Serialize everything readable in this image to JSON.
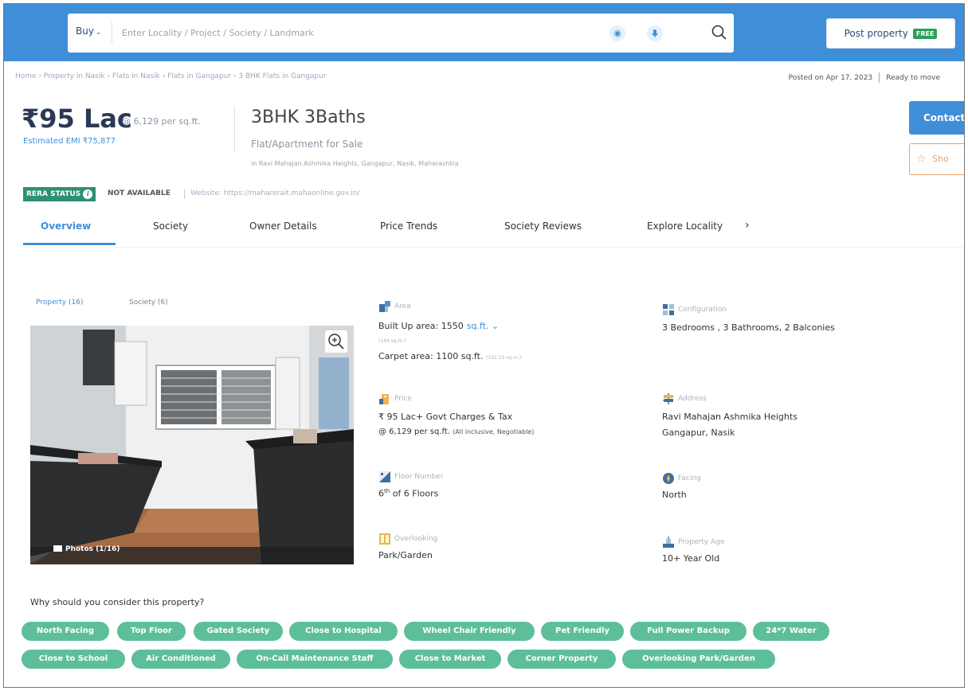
{
  "header": {
    "buy_label": "Buy",
    "search_placeholder": "Enter Locality / Project / Society / Landmark",
    "post_label": "Post property",
    "free_badge": "FREE"
  },
  "breadcrumb": "Home › Property in Nasik › Flats in Nasik › Flats in Gangapur › 3 BHK Flats in Gangapur",
  "posted": "Posted on Apr 17, 2023",
  "status": "Ready to move",
  "price": {
    "main": "₹95 Lac",
    "per_sqft": "@ 6,129 per sq.ft.",
    "emi": "Estimated EMI ₹75,877"
  },
  "listing": {
    "title": "3BHK 3Baths",
    "subtitle": "Flat/Apartment for Sale",
    "location": "in Ravi Mahajan Ashmika Heights, Gangapur, Nasik, Maharashtra"
  },
  "actions": {
    "contact": "Contact O",
    "shortlist": "Sho"
  },
  "rera": {
    "label": "RERA STATUS",
    "info": "i",
    "value": "NOT AVAILABLE",
    "website": "Website: https://maharerait.mahaonline.gov.in/"
  },
  "tabs": [
    "Overview",
    "Society",
    "Owner Details",
    "Price Trends",
    "Society Reviews",
    "Explore Locality"
  ],
  "gallery": {
    "property_tab": "Property (16)",
    "society_tab": "Society (6)",
    "photos_label": "Photos (1/16)"
  },
  "details": {
    "area": {
      "label": "Area",
      "built_up": "Built Up area: 1550",
      "unit": "sq.ft.",
      "built_up_m": "(144 sq.m.)",
      "carpet": "Carpet area: 1100 sq.ft.",
      "carpet_m": "(102.19 sq.m.)"
    },
    "configuration": {
      "label": "Configuration",
      "value": "3 Bedrooms , 3 Bathrooms, 2 Balconies"
    },
    "price": {
      "label": "Price",
      "value": "₹ 95 Lac+ Govt Charges & Tax",
      "per": "@ 6,129 per sq.ft.",
      "note": "(All inclusive, Negotiable)"
    },
    "address": {
      "label": "Address",
      "line1": "Ravi Mahajan Ashmika Heights",
      "line2": "Gangapur, Nasik"
    },
    "floor": {
      "label": "Floor Number",
      "value": "of 6 Floors",
      "floor_no": "6",
      "suffix": "th"
    },
    "facing": {
      "label": "Facing",
      "value": "North"
    },
    "overlooking": {
      "label": "Overlooking",
      "value": "Park/Garden"
    },
    "age": {
      "label": "Property Age",
      "value": "10+ Year Old"
    }
  },
  "why": {
    "title": "Why should you consider this property?",
    "row1": [
      "North Facing",
      "Top Floor",
      "Gated Society",
      "Close to Hospital",
      "Wheel Chair Friendly",
      "Pet Friendly",
      "Full Power Backup",
      "24*7 Water"
    ],
    "row2": [
      "Close to School",
      "Air Conditioned",
      "On-Call Maintenance Staff",
      "Close to Market",
      "Corner Property",
      "Overlooking Park/Garden"
    ]
  }
}
